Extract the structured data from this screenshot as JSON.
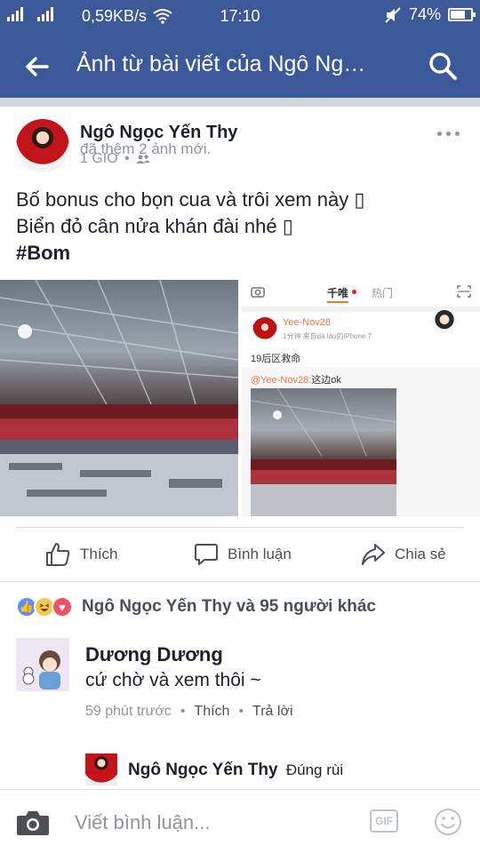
{
  "status_bar": {
    "speed": "0,59KB/s",
    "time": "17:10",
    "battery_text": "74%",
    "battery_level": 0.74,
    "icons": [
      "signal-icon",
      "signal-icon",
      "wifi-icon",
      "mute-icon",
      "battery-icon"
    ]
  },
  "app_bar": {
    "title": "Ảnh từ bài viết của Ngô Ng…",
    "background": "#3b5998"
  },
  "post": {
    "author": "Ngô Ngọc Yến Thy",
    "action": "đã thêm 2 ảnh mới.",
    "time": "1 GIỜ",
    "line1": "Bố bonus cho bọn cua và trôi xem này ",
    "line2": "Biển đỏ cân nửa khán đài nhé ",
    "hashtag": "#Bom",
    "screenshot": {
      "tab_active": "千唯",
      "tab_other": "热门",
      "user": "Yee-Nov28",
      "sub": "1分钟  来自dà lǎo的iPhone 7",
      "text1": "19后区救命",
      "mention": "@Yee-Nov28:",
      "text2": "这边ok"
    }
  },
  "actions": {
    "like": "Thích",
    "comment": "Bình luận",
    "share": "Chia sẻ"
  },
  "reactions": {
    "summary": "Ngô Ngọc Yến Thy và 95 người khác"
  },
  "comment": {
    "author": "Dương Dương",
    "text": "cứ chờ và xem thôi ~",
    "time": "59 phút trước",
    "like": "Thích",
    "reply": "Trả lời"
  },
  "reply": {
    "author": "Ngô Ngọc Yến Thy",
    "text": "Đúng rùi"
  },
  "composer": {
    "placeholder": "Viết bình luận...",
    "gif_label": "GIF"
  }
}
